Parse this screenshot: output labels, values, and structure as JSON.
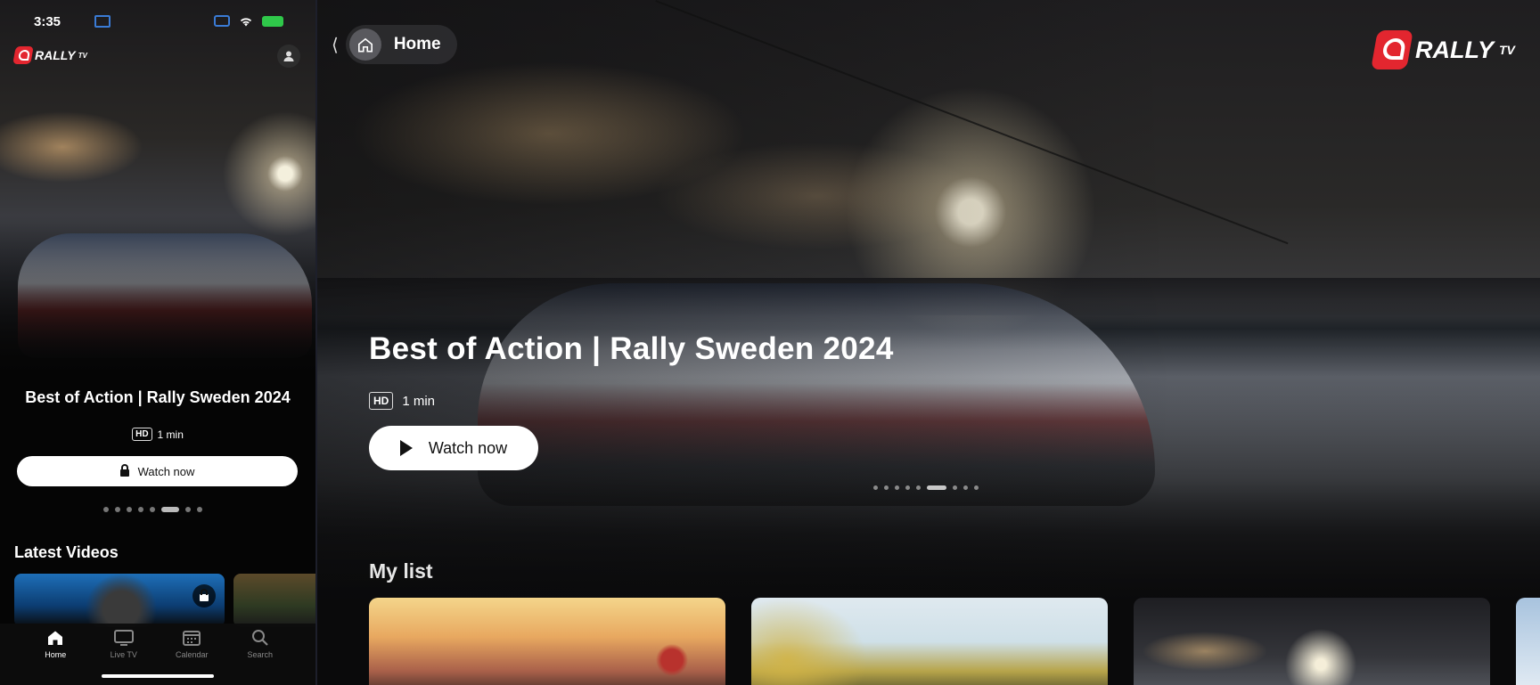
{
  "phone": {
    "status": {
      "time": "3:35"
    },
    "logo": {
      "text": "RALLY",
      "sup": "TV"
    },
    "hero": {
      "title": "Best of Action | Rally Sweden 2024",
      "quality": "HD",
      "duration": "1 min",
      "watch_label": "Watch now",
      "carousel": {
        "count": 8,
        "active_index": 5
      }
    },
    "latest_videos": {
      "heading": "Latest Videos"
    },
    "tabs": [
      {
        "label": "Home",
        "icon": "home-icon",
        "active": true
      },
      {
        "label": "Live TV",
        "icon": "tv-icon",
        "active": false
      },
      {
        "label": "Calendar",
        "icon": "calendar-icon",
        "active": false
      },
      {
        "label": "Search",
        "icon": "search-icon",
        "active": false
      }
    ]
  },
  "tv": {
    "nav": {
      "back_glyph": "⟨",
      "home_label": "Home"
    },
    "logo": {
      "text": "RALLY",
      "sup": "TV"
    },
    "hero": {
      "title": "Best of Action | Rally Sweden 2024",
      "quality": "HD",
      "duration": "1 min",
      "watch_label": "Watch now",
      "carousel": {
        "count": 9,
        "active_index": 5
      }
    },
    "my_list": {
      "heading": "My list"
    }
  },
  "colors": {
    "brand_red": "#e3262f",
    "background": "#0a0a0b",
    "button_bg": "#ffffff"
  }
}
